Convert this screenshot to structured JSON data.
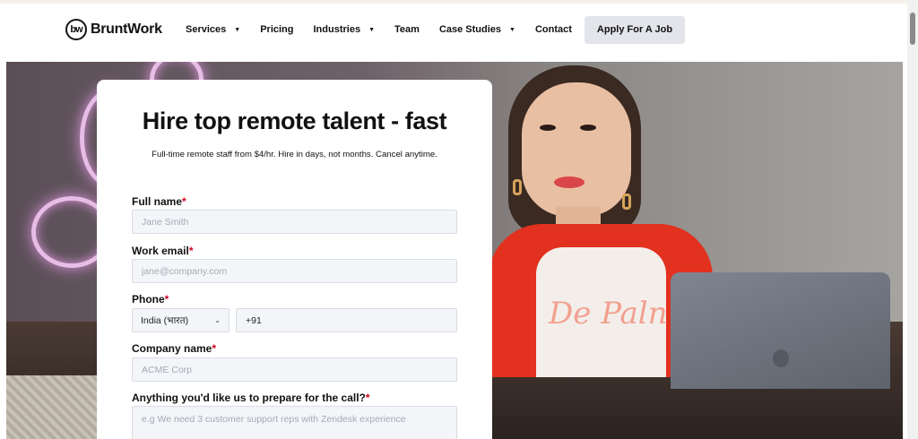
{
  "brand": {
    "logo_mark": "bw",
    "name": "BruntWork"
  },
  "nav": {
    "items": [
      {
        "label": "Services",
        "dropdown": true
      },
      {
        "label": "Pricing",
        "dropdown": false
      },
      {
        "label": "Industries",
        "dropdown": true
      },
      {
        "label": "Team",
        "dropdown": false
      },
      {
        "label": "Case Studies",
        "dropdown": true
      },
      {
        "label": "Contact",
        "dropdown": false
      }
    ],
    "cta": "Apply For A Job",
    "caret": "▼"
  },
  "hero": {
    "tshirt_print": "De Paln"
  },
  "form": {
    "title": "Hire top remote talent - fast",
    "subtitle": "Full-time remote staff from $4/hr. Hire in days, not months. Cancel anytime.",
    "required_mark": "*",
    "full_name": {
      "label": "Full name",
      "placeholder": "Jane Smith"
    },
    "work_email": {
      "label": "Work email",
      "placeholder": "jane@company.com"
    },
    "phone": {
      "label": "Phone",
      "country": "India (भारत)",
      "dial_code": "+91"
    },
    "company": {
      "label": "Company name",
      "placeholder": "ACME Corp"
    },
    "prepare": {
      "label": "Anything you'd like us to prepare for the call?",
      "placeholder": "e.g We need 3 customer support reps with Zendesk experience"
    }
  },
  "colors": {
    "accent_required": "#d0021b",
    "cta_bg": "#e3e5ea",
    "field_bg": "#f3f5f8"
  }
}
